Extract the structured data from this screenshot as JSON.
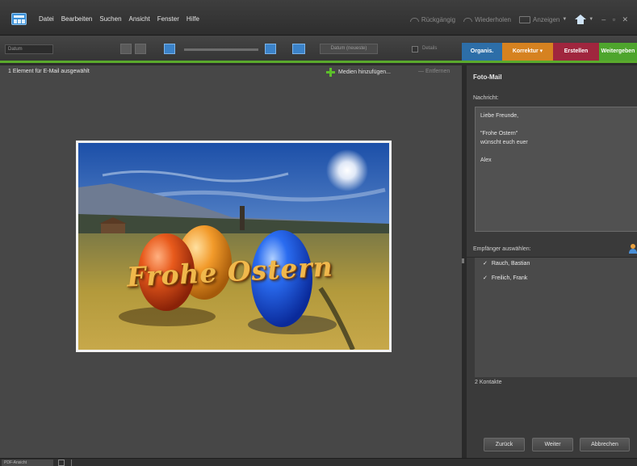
{
  "menubar": {
    "items": [
      "Datei",
      "Bearbeiten",
      "Suchen",
      "Ansicht",
      "Fenster",
      "Hilfe"
    ],
    "undo_label": "Rückgängig",
    "redo_label": "Wiederholen",
    "display_label": "Anzeigen",
    "window_controls": "– ▫ ✕"
  },
  "toolbar": {
    "sort_value": "Datum",
    "date_view_label": "Datum (neueste)",
    "details_label": "Details"
  },
  "tabs": {
    "organize": "Organis.",
    "fix": "Korrektur",
    "create": "Erstellen",
    "share": "Weitergeben"
  },
  "browser": {
    "status": "1 Element für E-Mail ausgewählt",
    "add_media": "Medien hinzufügen...",
    "remove": "Entfernen",
    "photo_caption": "Frohe Ostern"
  },
  "panel": {
    "title": "Foto-Mail",
    "message_label": "Nachricht:",
    "message_text": "Liebe Freunde,\n\n\"Frohe Ostern\"\nwünscht euch euer\n\nAlex",
    "recipients_label": "Empfänger auswählen:",
    "recipients": [
      "Rauch, Bastian",
      "Freilich, Frank"
    ],
    "contacts_count": "2 Kontakte",
    "back_button": "Zurück",
    "next_button": "Weiter",
    "cancel_button": "Abbrechen"
  },
  "statusbar": {
    "tab_label": "PDF-Ansicht"
  },
  "colors": {
    "organize": "#2d6ea8",
    "fix": "#d68220",
    "create": "#a0263e",
    "share": "#4ea52d"
  }
}
